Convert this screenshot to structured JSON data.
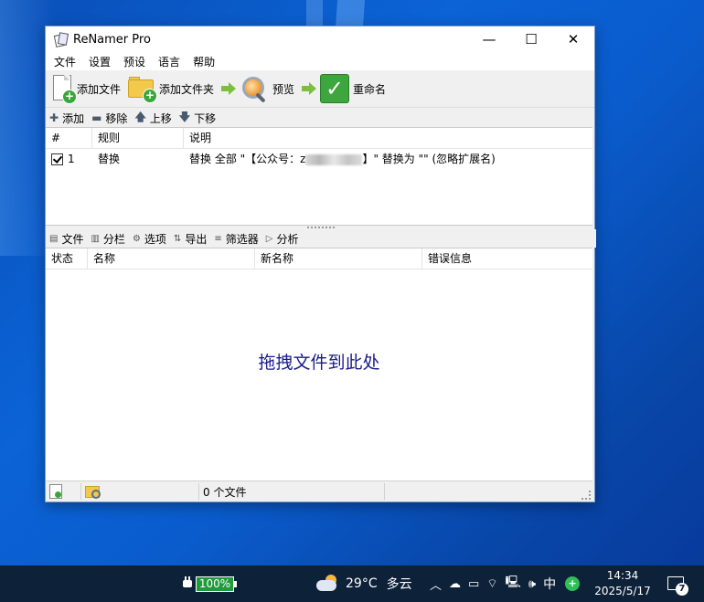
{
  "window": {
    "title": "ReNamer Pro",
    "controls": {
      "minimize": "—",
      "maximize": "☐",
      "close": "✕"
    }
  },
  "menu": [
    "文件",
    "设置",
    "预设",
    "语言",
    "帮助"
  ],
  "toolbar": {
    "add_files": "添加文件",
    "add_folders": "添加文件夹",
    "preview": "预览",
    "rename": "重命名"
  },
  "rules_toolbar": {
    "add": "添加",
    "remove": "移除",
    "move_up": "上移",
    "move_down": "下移"
  },
  "rules_table": {
    "headers": {
      "num": "#",
      "rule": "规则",
      "description": "说明"
    },
    "rows": [
      {
        "checked": true,
        "num": "1",
        "rule": "替换",
        "description_prefix": "替换 全部 \"【公众号：",
        "description_first_char": "z",
        "description_suffix": "】\" 替换为 \"\" (忽略扩展名)"
      }
    ]
  },
  "files_toolbar": {
    "files": "文件",
    "columns": "分栏",
    "options": "选项",
    "export": "导出",
    "filters": "筛选器",
    "analyze": "分析"
  },
  "files_table": {
    "headers": {
      "status": "状态",
      "name": "名称",
      "new_name": "新名称",
      "error": "错误信息"
    },
    "drop_hint": "拖拽文件到此处"
  },
  "statusbar": {
    "file_count": "0 个文件"
  },
  "taskbar": {
    "battery": "100%",
    "weather_temp": "29°C",
    "weather_desc": "多云",
    "ime": "中",
    "time": "14:34",
    "date": "2025/5/17",
    "notification_count": "7"
  },
  "colors": {
    "drop_hint": "#1a1a8c",
    "taskbar": "#0d2138",
    "battery": "#1e9b3c",
    "rename_icon": "#3da73d"
  }
}
